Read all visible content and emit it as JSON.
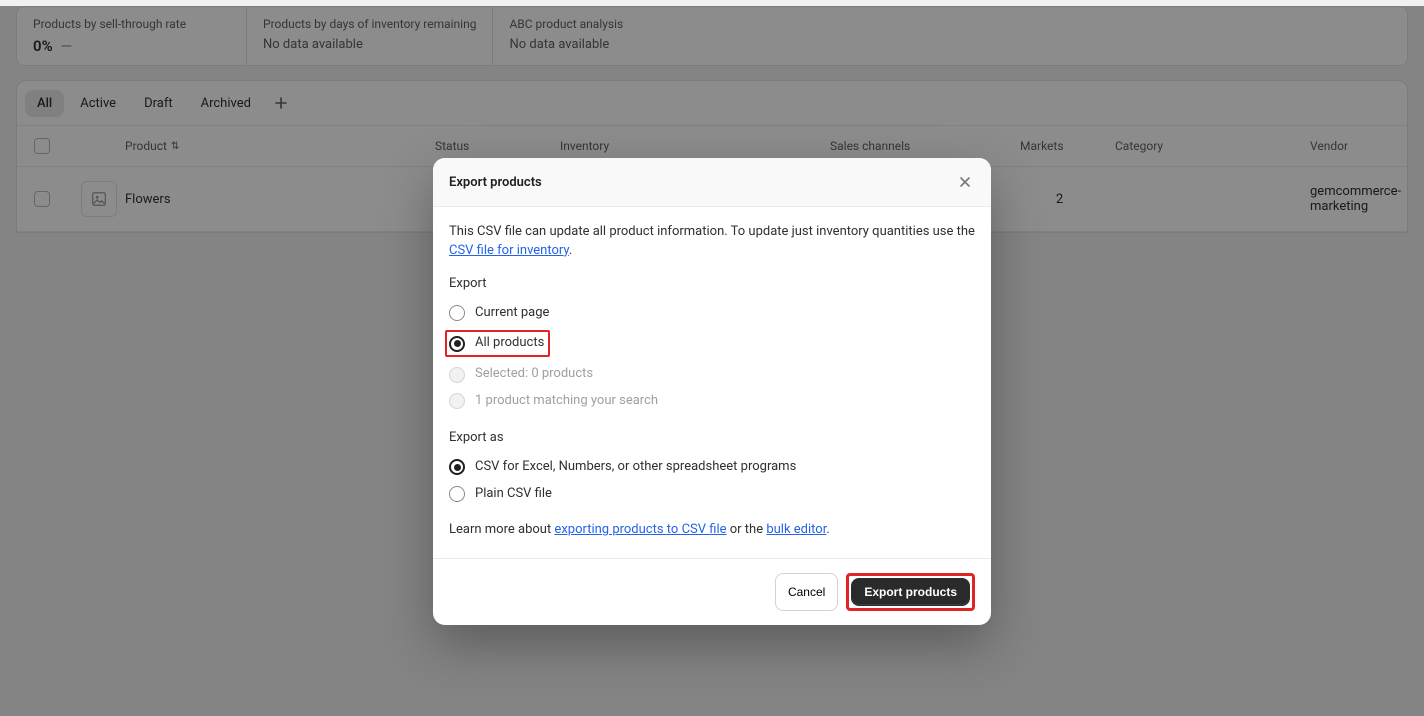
{
  "stats": [
    {
      "title": "Products by sell-through rate",
      "value": "0%",
      "extra": "—",
      "nodata": ""
    },
    {
      "title": "Products by days of inventory remaining",
      "value": "",
      "extra": "",
      "nodata": "No data available"
    },
    {
      "title": "ABC product analysis",
      "value": "",
      "extra": "",
      "nodata": "No data available"
    }
  ],
  "tabs": {
    "all": "All",
    "active": "Active",
    "draft": "Draft",
    "archived": "Archived"
  },
  "columns": {
    "product": "Product",
    "status": "Status",
    "inventory": "Inventory",
    "sales_channels": "Sales channels",
    "markets": "Markets",
    "category": "Category",
    "vendor": "Vendor"
  },
  "row": {
    "name": "Flowers",
    "markets": "2",
    "vendor": "gemcommerce-marketing"
  },
  "modal": {
    "title": "Export products",
    "intro_a": "This CSV file can update all product information. To update just inventory quantities use the ",
    "link_inventory": "CSV file for inventory",
    "intro_b": ".",
    "export_label": "Export",
    "opt_current": "Current page",
    "opt_all": "All products",
    "opt_selected": "Selected: 0 products",
    "opt_search": "1 product matching your search",
    "exportas_label": "Export as",
    "fmt_csv": "CSV for Excel, Numbers, or other spreadsheet programs",
    "fmt_plain": "Plain CSV file",
    "learn_a": "Learn more about ",
    "link_export": "exporting products to CSV file",
    "learn_b": " or the ",
    "link_bulk": "bulk editor",
    "learn_c": ".",
    "cancel": "Cancel",
    "submit": "Export products"
  }
}
